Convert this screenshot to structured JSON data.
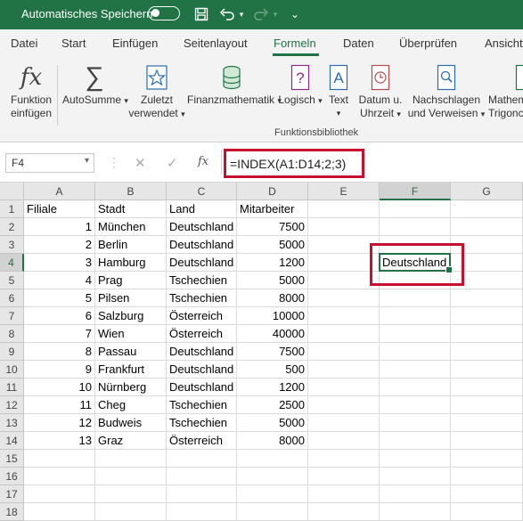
{
  "titlebar": {
    "autosave_label": "Automatisches Speichern",
    "icons": [
      "toggle-off",
      "save-icon",
      "undo-icon",
      "dropdown-icon",
      "redo-icon",
      "dropdown-icon"
    ]
  },
  "menu": {
    "tabs": [
      "Datei",
      "Start",
      "Einfügen",
      "Seitenlayout",
      "Formeln",
      "Daten",
      "Überprüfen",
      "Ansicht"
    ],
    "active": "Formeln"
  },
  "ribbon": {
    "buttons": [
      {
        "line1": "Funktion",
        "line2": "einfügen",
        "icon": "fx-icon"
      },
      {
        "line1": "AutoSumme",
        "line2": "",
        "icon": "sigma-icon"
      },
      {
        "line1": "Zuletzt",
        "line2": "verwendet",
        "icon": "star-icon"
      },
      {
        "line1": "Finanzmathematik",
        "line2": "",
        "icon": "coins-icon"
      },
      {
        "line1": "Logisch",
        "line2": "",
        "icon": "question-icon"
      },
      {
        "line1": "Text",
        "line2": "",
        "icon": "text-icon"
      },
      {
        "line1": "Datum u.",
        "line2": "Uhrzeit",
        "icon": "clock-icon"
      },
      {
        "line1": "Nachschlagen",
        "line2": "und Verweisen",
        "icon": "lookup-icon"
      },
      {
        "line1": "Mathem",
        "line2": "Trigonc",
        "icon": "math-icon"
      }
    ],
    "group_label": "Funktionsbibliothek"
  },
  "formula_bar": {
    "name_box": "F4",
    "formula": "=INDEX(A1:D14;2;3)",
    "fx": "fx"
  },
  "sheet": {
    "columns": [
      "A",
      "B",
      "C",
      "D",
      "E",
      "F",
      "G"
    ],
    "selected_column": "F",
    "selected_row": 4,
    "rows": [
      {
        "n": "1",
        "a": "Filiale",
        "b": "Stadt",
        "c": "Land",
        "d": "Mitarbeiter",
        "f": ""
      },
      {
        "n": "2",
        "a": "1",
        "b": "München",
        "c": "Deutschland",
        "d": "7500",
        "f": ""
      },
      {
        "n": "3",
        "a": "2",
        "b": "Berlin",
        "c": "Deutschland",
        "d": "5000",
        "f": ""
      },
      {
        "n": "4",
        "a": "3",
        "b": "Hamburg",
        "c": "Deutschland",
        "d": "1200",
        "f": "Deutschland"
      },
      {
        "n": "5",
        "a": "4",
        "b": "Prag",
        "c": "Tschechien",
        "d": "5000",
        "f": ""
      },
      {
        "n": "6",
        "a": "5",
        "b": "Pilsen",
        "c": "Tschechien",
        "d": "8000",
        "f": ""
      },
      {
        "n": "7",
        "a": "6",
        "b": "Salzburg",
        "c": "Österreich",
        "d": "10000",
        "f": ""
      },
      {
        "n": "8",
        "a": "7",
        "b": "Wien",
        "c": "Österreich",
        "d": "40000",
        "f": ""
      },
      {
        "n": "9",
        "a": "8",
        "b": "Passau",
        "c": "Deutschland",
        "d": "7500",
        "f": ""
      },
      {
        "n": "10",
        "a": "9",
        "b": "Frankfurt",
        "c": "Deutschland",
        "d": "500",
        "f": ""
      },
      {
        "n": "11",
        "a": "10",
        "b": "Nürnberg",
        "c": "Deutschland",
        "d": "1200",
        "f": ""
      },
      {
        "n": "12",
        "a": "11",
        "b": "Cheg",
        "c": "Tschechien",
        "d": "2500",
        "f": ""
      },
      {
        "n": "13",
        "a": "12",
        "b": "Budweis",
        "c": "Tschechien",
        "d": "5000",
        "f": ""
      },
      {
        "n": "14",
        "a": "13",
        "b": "Graz",
        "c": "Österreich",
        "d": "8000",
        "f": ""
      },
      {
        "n": "15",
        "a": "",
        "b": "",
        "c": "",
        "d": "",
        "f": ""
      },
      {
        "n": "16",
        "a": "",
        "b": "",
        "c": "",
        "d": "",
        "f": ""
      },
      {
        "n": "17",
        "a": "",
        "b": "",
        "c": "",
        "d": "",
        "f": ""
      },
      {
        "n": "18",
        "a": "",
        "b": "",
        "c": "",
        "d": "",
        "f": ""
      }
    ]
  },
  "colors": {
    "excel_green": "#217346",
    "highlight_red": "#c8102e"
  }
}
